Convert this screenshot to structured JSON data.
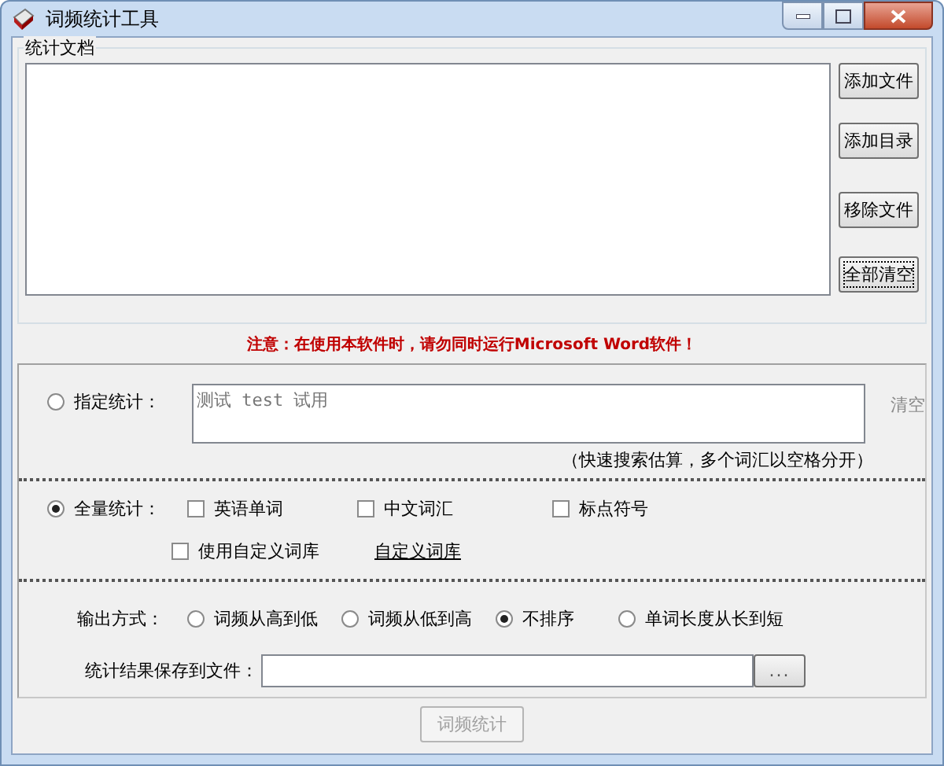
{
  "window": {
    "title": "词频统计工具"
  },
  "documents": {
    "label": "统计文档",
    "buttons": [
      {
        "label": "添加文件",
        "focused": false
      },
      {
        "label": "添加目录",
        "focused": false
      },
      {
        "label": "移除文件",
        "focused": false
      },
      {
        "label": "全部清空",
        "focused": true
      }
    ]
  },
  "notice": "注意：在使用本软件时，请勿同时运行Microsoft Word软件！",
  "specified": {
    "label": "指定统计：",
    "selected": false,
    "placeholder": "测试 test 试用",
    "clear": {
      "label": "清空",
      "disabled": true
    },
    "hint": "（快速搜索估算，多个词汇以空格分开）"
  },
  "full": {
    "label": "全量统计：",
    "selected": true,
    "options": [
      {
        "label": "英语单词",
        "checked": false
      },
      {
        "label": "中文词汇",
        "checked": false
      },
      {
        "label": "标点符号",
        "checked": false
      }
    ],
    "custom_library": {
      "label": "使用自定义词库",
      "checked": false
    },
    "custom_library_link": "自定义词库"
  },
  "output": {
    "label": "输出方式：",
    "options": [
      {
        "label": "词频从高到低",
        "selected": false
      },
      {
        "label": "词频从低到高",
        "selected": false
      },
      {
        "label": "不排序",
        "selected": true
      },
      {
        "label": "单词长度从长到短",
        "selected": false
      }
    ]
  },
  "save": {
    "label": "统计结果保存到文件：",
    "browse": "..."
  },
  "run_button": {
    "label": "词频统计",
    "disabled": true
  }
}
